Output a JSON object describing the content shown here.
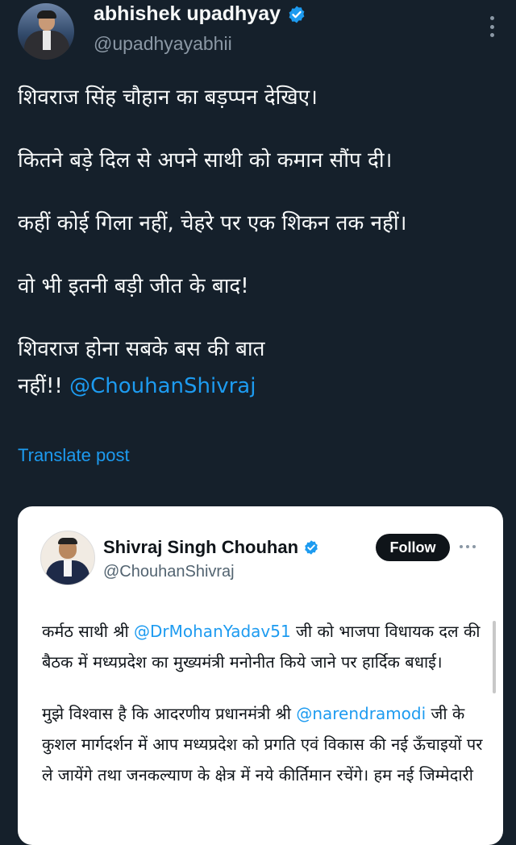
{
  "author": {
    "display_name": "abhishek upadhyay",
    "handle": "@upadhyayabhii"
  },
  "tweet": {
    "lines": [
      "शिवराज सिंह चौहान का बड़प्पन देखिए।",
      "कितने बड़े दिल से अपने साथी को कमान सौंप दी।",
      "कहीं कोई गिला नहीं, चेहरे पर एक शिकन तक नहीं।",
      "वो भी इतनी बड़ी जीत के बाद!",
      "शिवराज होना सबके बस की बात",
      "नहीं!! "
    ],
    "mention": "@ChouhanShivraj",
    "translate_label": "Translate post"
  },
  "quoted": {
    "display_name": "Shivraj Singh Chouhan",
    "handle": "@ChouhanShivraj",
    "follow_label": "Follow",
    "para1": {
      "pre": "कर्मठ साथी श्री ",
      "mention": "@DrMohanYadav51",
      "post": " जी को भाजपा विधायक दल की बैठक में मध्यप्रदेश का मुख्यमंत्री मनोनीत किये जाने पर हार्दिक बधाई।"
    },
    "para2": {
      "pre": "मुझे विश्वास है कि आदरणीय प्रधानमंत्री श्री ",
      "mention": "@narendramodi",
      "post": " जी के कुशल मार्गदर्शन में आप मध्यप्रदेश को प्रगति एवं विकास की नई ऊँचाइयों पर ले जायेंगे तथा जनकल्याण के क्षेत्र में नये कीर्तिमान रचेंगे। हम नई जिम्मेदारी"
    }
  },
  "colors": {
    "background": "#15202b",
    "accent": "#1d9bf0",
    "card": "#ffffff"
  },
  "icons": {
    "verified": "verified-badge-icon",
    "more": "more-options-icon"
  }
}
